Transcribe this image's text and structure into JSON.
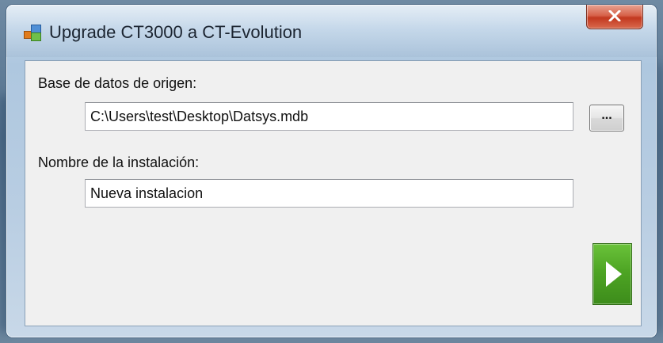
{
  "window": {
    "title": "Upgrade CT3000 a CT-Evolution",
    "close_label": "x"
  },
  "form": {
    "source_db": {
      "label": "Base de datos de origen:",
      "value": "C:\\Users\\test\\Desktop\\Datsys.mdb",
      "browse_label": "..."
    },
    "install_name": {
      "label": "Nombre de la instalación:",
      "value": "Nueva instalacion"
    },
    "run_button_icon": "play-icon"
  },
  "colors": {
    "accent_green": "#4ea524",
    "close_red": "#c2381f",
    "chrome_blue": "#b8cde2"
  }
}
